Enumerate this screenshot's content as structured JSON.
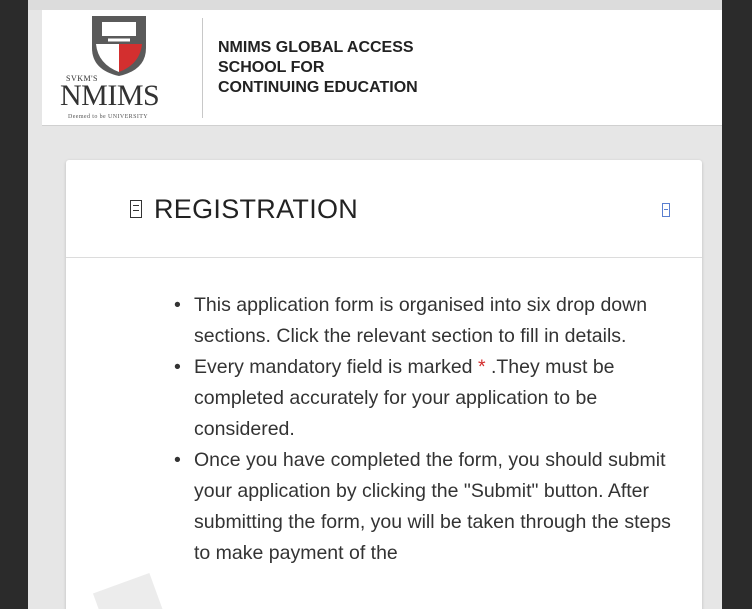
{
  "header": {
    "logo": {
      "sub": "SVKM'S",
      "wordmark": "NMIMS",
      "tagline": "Deemed to be UNIVERSITY"
    },
    "org_name_lines": [
      "NMIMS GLOBAL ACCESS",
      "SCHOOL FOR",
      "CONTINUING EDUCATION"
    ]
  },
  "card": {
    "title_icon": "document-icon",
    "title": "REGISTRATION",
    "collapse_icon": "collapse-icon",
    "instructions": [
      {
        "bullet": "•",
        "text": "This application form is organised into six drop down sections. Click the relevant section to fill in details."
      },
      {
        "bullet": "•",
        "text_before": "Every mandatory field is marked ",
        "star": "*",
        "text_after": " .They must be completed accurately for your application to be considered."
      },
      {
        "bullet": "•",
        "text": "Once you have completed the form, you should submit your application by clicking the \"Submit\" button. After submitting the form, you will be taken through the steps to make payment of the"
      }
    ]
  },
  "colors": {
    "brand_red": "#d32f2f",
    "link_blue": "#5a7fd0",
    "text_dark": "#222222"
  }
}
